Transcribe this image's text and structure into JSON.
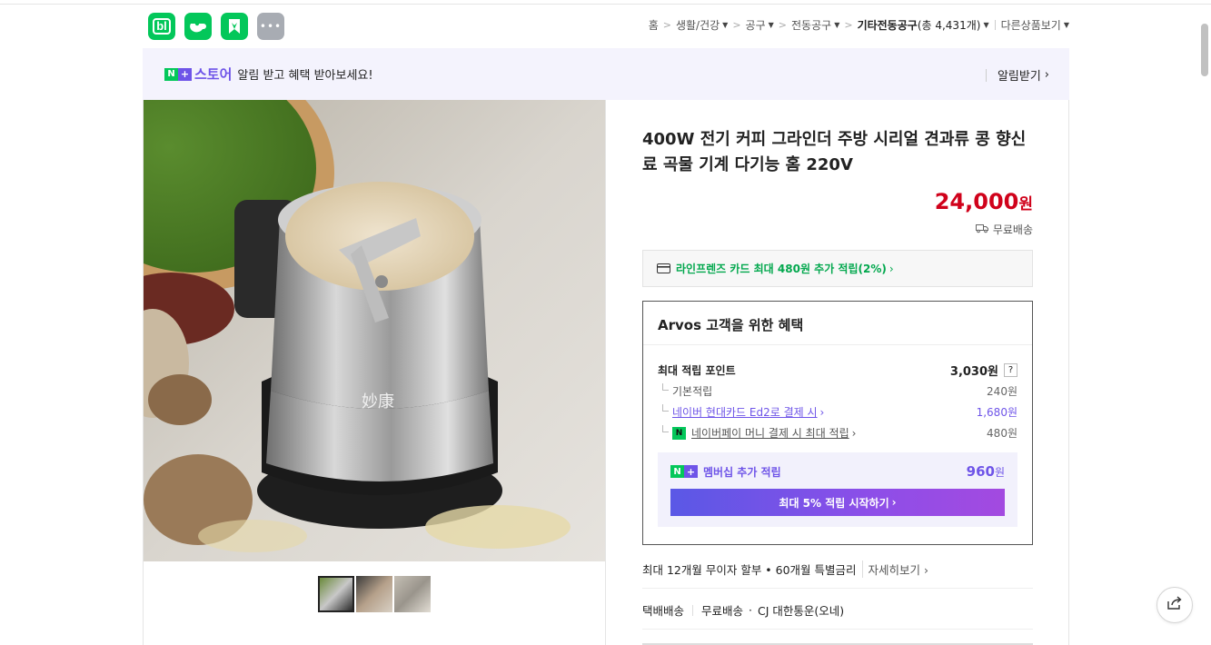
{
  "app_icons": [
    {
      "name": "blog-icon",
      "glyph": "bl"
    },
    {
      "name": "cafe-icon",
      "glyph": ""
    },
    {
      "name": "kakao-icon",
      "glyph": ""
    },
    {
      "name": "more-icon",
      "glyph": "•••"
    }
  ],
  "breadcrumb": {
    "items": [
      "홈",
      "생활/건강",
      "공구",
      "전동공구"
    ],
    "current": "기타전동공구",
    "count_text": "(총 4,431개)",
    "other": "다른상품보기"
  },
  "notify": {
    "n_badge": "N",
    "plus_badge": "+",
    "store": "스토어",
    "message": "알림 받고 혜택 받아보세요!",
    "button": "알림받기"
  },
  "product": {
    "title": "400W 전기 커피 그라인더 주방 시리얼 견과류 콩 향신료 곡물 기계 다기능 홈 220V",
    "price": "24,000",
    "price_unit": "원",
    "shipping": "무료배송"
  },
  "card_promo": "라인프렌즈 카드 최대 480원 추가 적립(2%)",
  "benefit": {
    "title": "Arvos 고객을 위한 혜택",
    "max_points_label": "최대 적립 포인트",
    "max_points_value": "3,030원",
    "help": "?",
    "rows": [
      {
        "label": "기본적립",
        "value": "240원"
      },
      {
        "label": "네이버 현대카드 Ed2로 결제 시",
        "value": "1,680원"
      },
      {
        "label": "네이버페이 머니 결제 시 최대 적립",
        "value": "480원"
      }
    ],
    "npay_badge": "N",
    "membership_label": "멤버십 추가 적립",
    "membership_value": "960",
    "membership_unit": "원",
    "membership_button": "최대 5% 적립 시작하기"
  },
  "installment": {
    "text": "최대 12개월 무이자 할부 • 60개월 특별금리",
    "more": "자세히보기"
  },
  "delivery": {
    "type": "택배배송",
    "fee": "무료배송",
    "courier": "CJ 대한통운(오네)"
  },
  "colors": {
    "accent_green": "#03c75a",
    "accent_purple": "#6e54e8",
    "price_red": "#d0021b"
  }
}
